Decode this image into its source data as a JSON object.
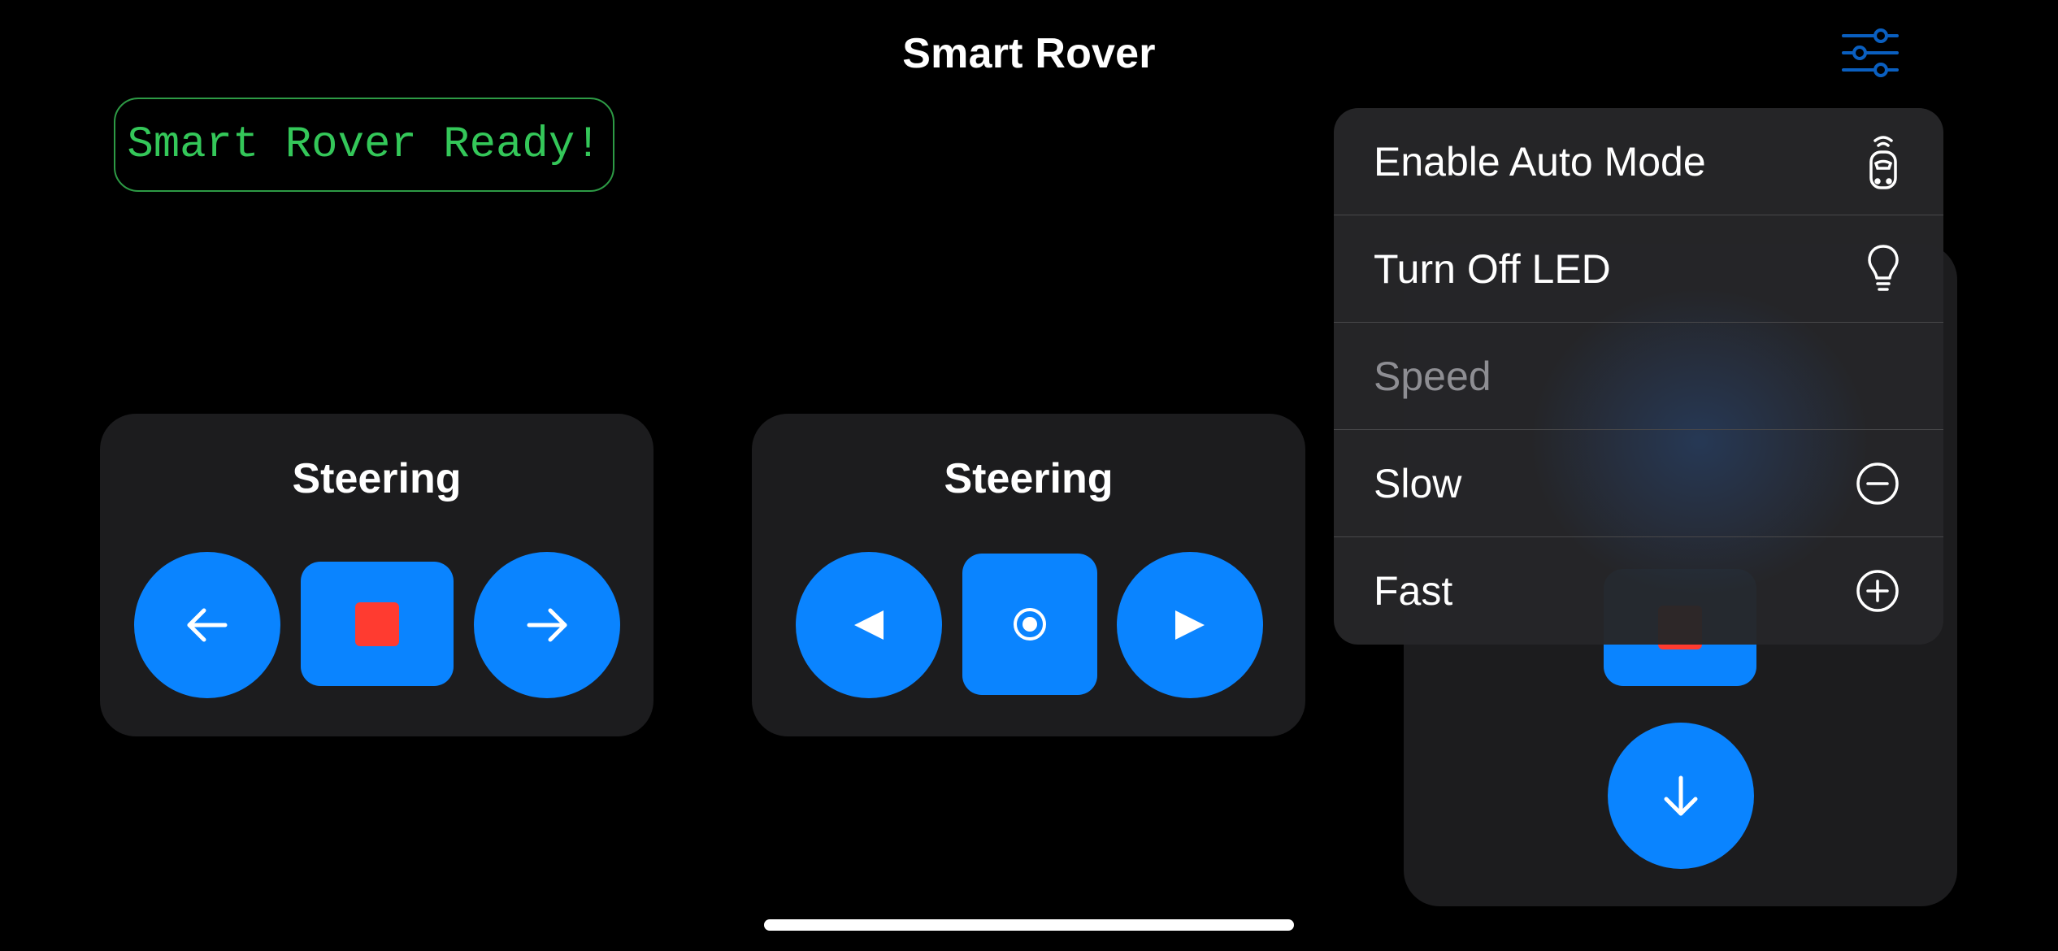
{
  "app": {
    "title": "Smart Rover"
  },
  "status": {
    "text": "Smart Rover Ready!"
  },
  "cards": [
    {
      "title": "Steering",
      "left_icon": "arrow-left-icon",
      "center_icon": "stop-square-icon",
      "right_icon": "arrow-right-icon"
    },
    {
      "title": "Steering",
      "left_icon": "triangle-left-icon",
      "center_icon": "record-circle-icon",
      "right_icon": "triangle-right-icon"
    },
    {
      "title": "",
      "down_icon": "arrow-down-icon"
    }
  ],
  "menu": {
    "items": [
      {
        "label": "Enable Auto Mode",
        "icon": "car-wireless-icon"
      },
      {
        "label": "Turn Off LED",
        "icon": "lightbulb-icon"
      },
      {
        "label": "Speed",
        "header": true
      },
      {
        "label": "Slow",
        "icon": "minus-circle-icon"
      },
      {
        "label": "Fast",
        "icon": "plus-circle-icon"
      }
    ]
  },
  "colors": {
    "accent": "#0a84ff",
    "status_green": "#34c759",
    "stop_red": "#ff3b30",
    "card_bg": "#1c1c1e"
  }
}
